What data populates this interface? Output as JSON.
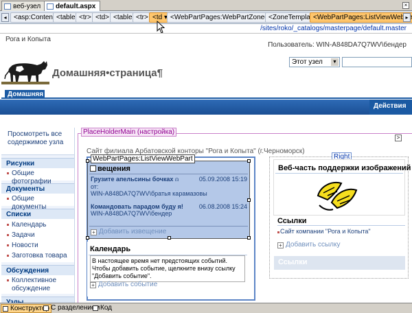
{
  "doc_tabs": [
    "веб-узел",
    "default.aspx"
  ],
  "tag_bar": {
    "tags": [
      "<asp:Content>",
      "<table>",
      "<tr>",
      "<td>",
      "<table>",
      "<tr>",
      "<td ▾",
      "<WebPartPages:WebPartZone#Left>",
      "<ZoneTemplate>",
      "<WebPartPages:ListViewWebPart>"
    ],
    "selected_index": 6
  },
  "path": "/sites/roko/_catalogs/masterpage/default.master",
  "site_name": "Рога и Копыта",
  "user_label": "Пользователь: WIN-A848DA7Q7WV\\бендер",
  "page_title": "Домашняя•страница¶",
  "scope_select": "Этот узел",
  "home_tab": "Домашняя",
  "actions_label": "Действия",
  "leftnav": {
    "view_all": "Просмотреть все содержимое узла",
    "sections": [
      {
        "title": "Рисунки",
        "items": [
          "Общие фотографии"
        ]
      },
      {
        "title": "Документы",
        "items": [
          "Общие документы"
        ]
      },
      {
        "title": "Списки",
        "items": [
          "Календарь",
          "Задачи",
          "Новости",
          "Заготовка товара"
        ]
      },
      {
        "title": "Обсуждения",
        "items": [
          "Коллективное обсуждение"
        ]
      },
      {
        "title": "Узлы",
        "items": []
      }
    ]
  },
  "placeholder_label": "PlaceHolderMain (настройка)",
  "breadcrumb": "Сайт филиала Арбатовской конторы \"Рога и Копыта\" (г.Черноморск)",
  "right_zone_label": "Right",
  "announcements": {
    "part_label": "WebPartPages:ListViewWebPart",
    "title_fragment": "вещения",
    "items": [
      {
        "title": "Грузите апельсины бочках",
        "from": "от:",
        "author": "WIN-A848DA7Q7WV\\братья карамазовы",
        "date": "05.09.2008 15:19"
      },
      {
        "title": "Командовать парадом буду я!",
        "from": "от:",
        "author": "WIN-A848DA7Q7WV\\бендер",
        "date": "06.08.2008 15:24"
      }
    ],
    "add_label": "Добавить извещение"
  },
  "calendar": {
    "title": "Календарь",
    "body": "В настоящее время нет предстоящих событий. Чтобы добавить событие, щелкните внизу ссылку \"Добавить событие\".",
    "add_label": "Добавить событие"
  },
  "image_part": {
    "title": "Веб-часть поддержки изображений"
  },
  "links": {
    "title": "Ссылки",
    "items": [
      "Сайт компании \"Рога и Копыта\""
    ],
    "add_label": "Добавить ссылку",
    "footer": "Ссылки"
  },
  "bottom_views": [
    "Конструктор",
    "С разделением",
    "Код"
  ],
  "colors": {
    "accent": "#1b5aa3",
    "tag_selected": "#ffc66c",
    "placeholder": "#c980c9"
  }
}
